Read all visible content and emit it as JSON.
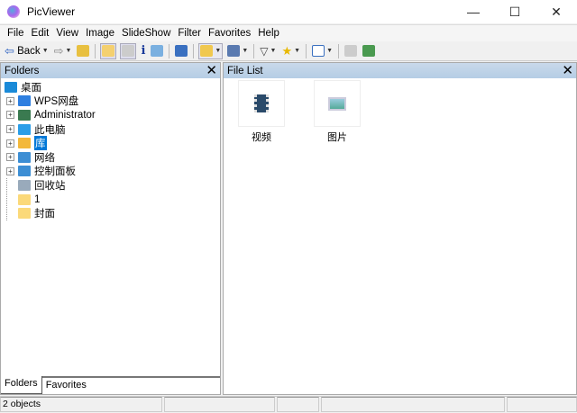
{
  "window": {
    "title": "PicViewer",
    "minimize": "—",
    "maximize": "☐",
    "close": "✕"
  },
  "menu": [
    "File",
    "Edit",
    "View",
    "Image",
    "SlideShow",
    "Filter",
    "Favorites",
    "Help"
  ],
  "toolbar": {
    "back_label": "Back"
  },
  "folders_panel": {
    "title": "Folders",
    "tree": [
      {
        "label": "桌面",
        "icon": "desktop",
        "color": "#1a8ad8",
        "root": true
      },
      {
        "label": "WPS网盘",
        "icon": "cloud",
        "color": "#2e7fe0",
        "expandable": true
      },
      {
        "label": "Administrator",
        "icon": "user",
        "color": "#3a7a50",
        "expandable": true
      },
      {
        "label": "此电脑",
        "icon": "computer",
        "color": "#2a9ee8",
        "expandable": true
      },
      {
        "label": "库",
        "icon": "library",
        "color": "#f3b83a",
        "expandable": true,
        "selected": true
      },
      {
        "label": "网络",
        "icon": "network",
        "color": "#3c8ed4",
        "expandable": true
      },
      {
        "label": "控制面板",
        "icon": "control-panel",
        "color": "#3c8ed4",
        "expandable": true
      },
      {
        "label": "回收站",
        "icon": "recycle-bin",
        "color": "#9ab"
      },
      {
        "label": "1",
        "icon": "folder",
        "color": "#fbd97a"
      },
      {
        "label": "封面",
        "icon": "folder",
        "color": "#fbd97a"
      }
    ],
    "tabs": [
      "Folders",
      "Favorites"
    ]
  },
  "file_list": {
    "title": "File List",
    "items": [
      {
        "label": "视频",
        "icon": "video-library"
      },
      {
        "label": "图片",
        "icon": "picture-library"
      }
    ]
  },
  "status": {
    "objects": "2 objects"
  }
}
